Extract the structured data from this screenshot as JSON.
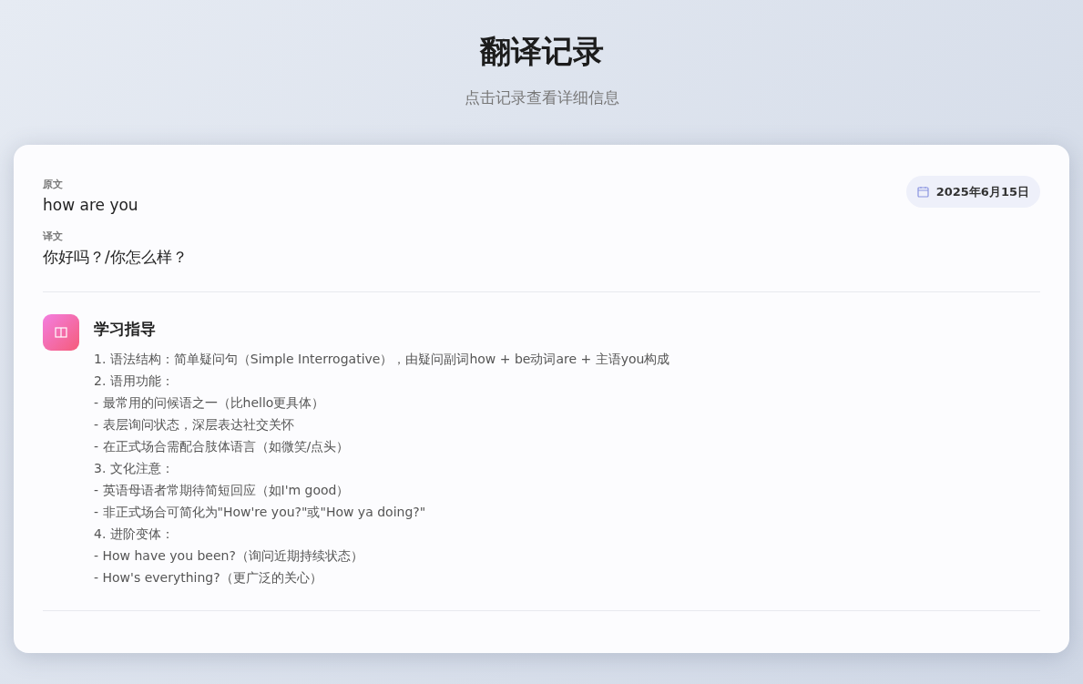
{
  "header": {
    "title": "翻译记录",
    "subtitle": "点击记录查看详细信息"
  },
  "record": {
    "source_label": "原文",
    "source_text": "how are you",
    "translation_label": "译文",
    "translation_text": "你好吗？/你怎么样？",
    "date": "2025年6月15日",
    "guide": {
      "title": "学习指导",
      "lines": [
        "1. 语法结构：简单疑问句（Simple Interrogative），由疑问副词how + be动词are + 主语you构成",
        "2. 语用功能：",
        "- 最常用的问候语之一（比hello更具体）",
        "- 表层询问状态，深层表达社交关怀",
        "- 在正式场合需配合肢体语言（如微笑/点头）",
        "3. 文化注意：",
        "- 英语母语者常期待简短回应（如I'm good）",
        "- 非正式场合可简化为\"How're you?\"或\"How ya doing?\"",
        "4. 进阶变体：",
        "- How have you been?（询问近期持续状态）",
        "- How's everything?（更广泛的关心）"
      ]
    }
  }
}
